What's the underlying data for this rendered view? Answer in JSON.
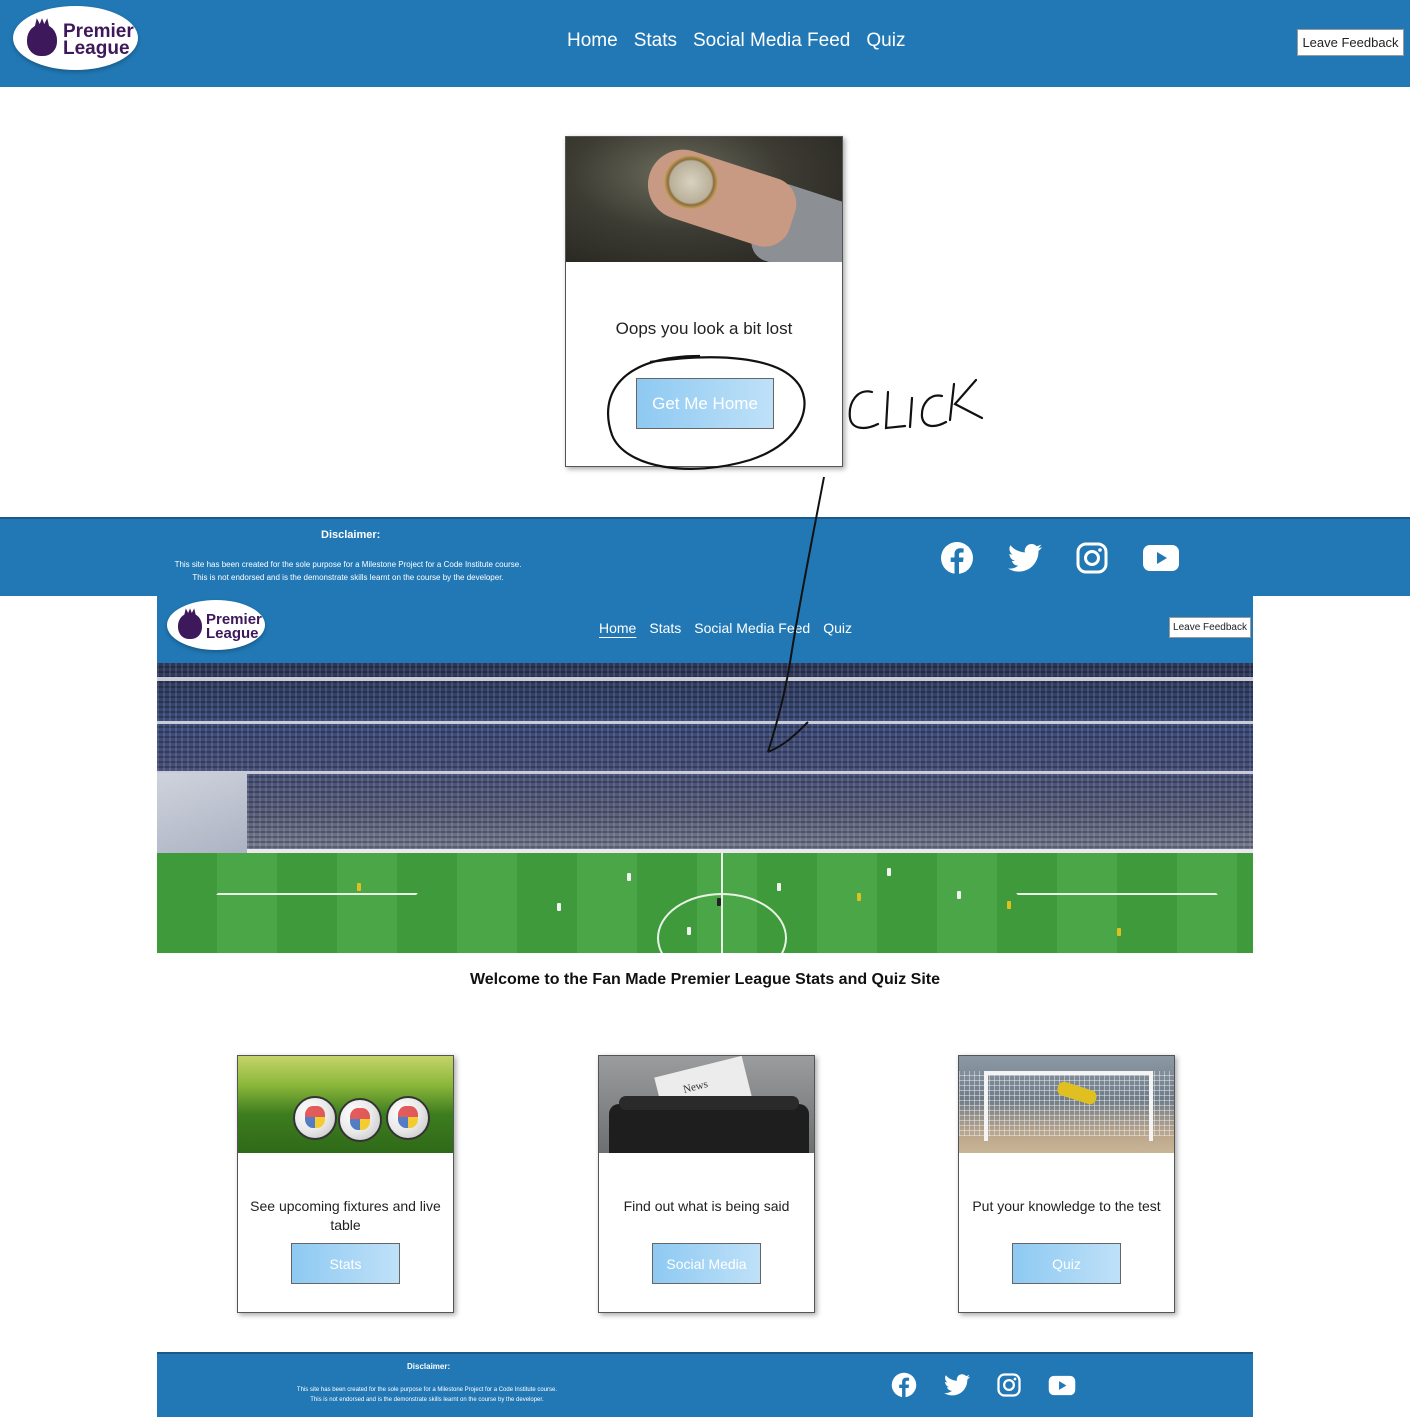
{
  "brand": {
    "logo_line1": "Premier",
    "logo_line2": "League",
    "header_color": "#2178b5",
    "logo_color": "#3d195b"
  },
  "error_page": {
    "nav": [
      "Home",
      "Stats",
      "Social Media Feed",
      "Quiz"
    ],
    "feedback_label": "Leave Feedback",
    "card": {
      "message": "Oops you look a bit lost",
      "button_label": "Get Me Home"
    },
    "footer": {
      "disclaimer_title": "Disclaimer:",
      "disclaimer_line1": "This site has been created for the sole purpose for a Milestone Project for a Code Institute course.",
      "disclaimer_line2": "This is not endorsed and is the demonstrate skills learnt on the course by the developer.",
      "social_icons": [
        "facebook-icon",
        "twitter-icon",
        "instagram-icon",
        "youtube-icon"
      ]
    }
  },
  "annotation": {
    "handwritten_text": "CLICK"
  },
  "home_page": {
    "nav": [
      "Home",
      "Stats",
      "Social Media Feed",
      "Quiz"
    ],
    "active_nav": "Home",
    "feedback_label": "Leave Feedback",
    "welcome": "Welcome to the Fan Made Premier League Stats and Quiz Site",
    "cards": [
      {
        "text": "See upcoming fixtures and live table",
        "button": "Stats"
      },
      {
        "text": "Find out what is being said",
        "button": "Social Media"
      },
      {
        "text": "Put your knowledge to the test",
        "button": "Quiz"
      }
    ],
    "footer": {
      "disclaimer_title": "Disclaimer:",
      "disclaimer_line1": "This site has been created for the sole purpose for a Milestone Project for a Code Institute course.",
      "disclaimer_line2": "This is not endorsed and is the demonstrate skills learnt on the course by the developer."
    }
  }
}
